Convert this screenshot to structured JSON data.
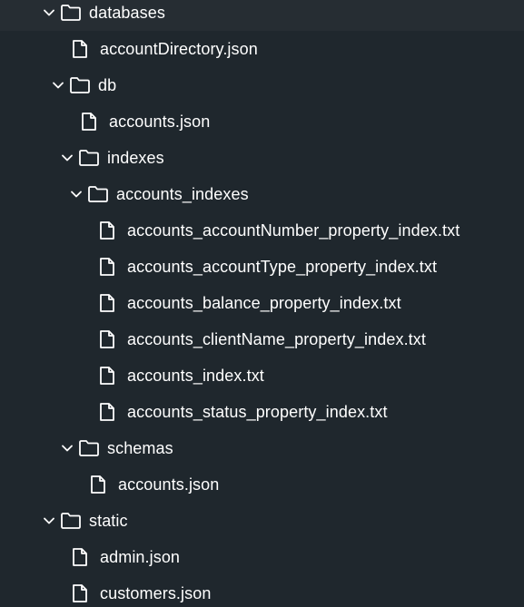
{
  "tree": {
    "items": [
      {
        "label": "databases",
        "type": "folder",
        "expanded": true
      },
      {
        "label": "accountDirectory.json",
        "type": "file"
      },
      {
        "label": "db",
        "type": "folder",
        "expanded": true
      },
      {
        "label": "accounts.json",
        "type": "file"
      },
      {
        "label": "indexes",
        "type": "folder",
        "expanded": true
      },
      {
        "label": "accounts_indexes",
        "type": "folder",
        "expanded": true
      },
      {
        "label": "accounts_accountNumber_property_index.txt",
        "type": "file"
      },
      {
        "label": "accounts_accountType_property_index.txt",
        "type": "file"
      },
      {
        "label": "accounts_balance_property_index.txt",
        "type": "file"
      },
      {
        "label": "accounts_clientName_property_index.txt",
        "type": "file"
      },
      {
        "label": "accounts_index.txt",
        "type": "file"
      },
      {
        "label": "accounts_status_property_index.txt",
        "type": "file"
      },
      {
        "label": "schemas",
        "type": "folder",
        "expanded": true
      },
      {
        "label": "accounts.json",
        "type": "file"
      },
      {
        "label": "static",
        "type": "folder",
        "expanded": true
      },
      {
        "label": "admin.json",
        "type": "file"
      },
      {
        "label": "customers.json",
        "type": "file"
      }
    ]
  },
  "colors": {
    "background": "#1f272d",
    "text": "#ffffff",
    "icon": "#ffffff"
  },
  "icons": {
    "folder": "folder-icon",
    "file": "file-icon",
    "chevron": "chevron-down-icon"
  }
}
